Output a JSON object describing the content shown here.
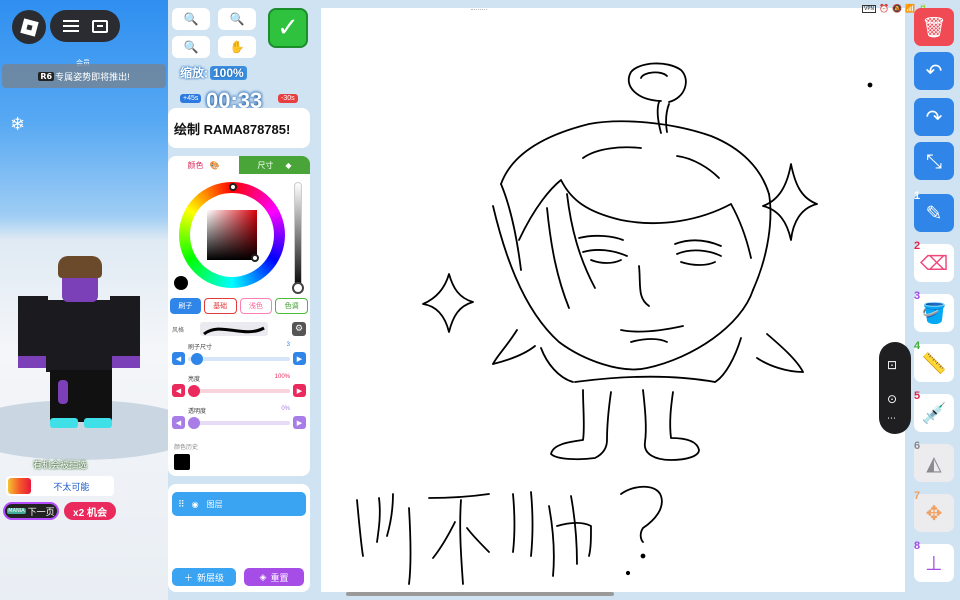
{
  "scene": {
    "tiny_label": "会员",
    "announcement_badge": "R6",
    "announcement_text": "专属姿势即将推出!",
    "snow_icon": "❄",
    "chance_label": "有机会被抽选",
    "chance_status": "不太可能",
    "chance_fill_fraction": 0.22,
    "next_button_badge": "MANIA",
    "next_button_label": "下一页",
    "x2_button_label": "x2 机会"
  },
  "toolbar_top": {
    "zoom_out_icon": "🔍",
    "zoom_in_icon": "🔍",
    "zoom_fit_icon": "🔍",
    "hand_icon": "✋",
    "confirm_icon": "✓",
    "zoom_label": "缩放:",
    "zoom_value": "100%"
  },
  "timer": {
    "plus_badge": "+45s",
    "minus_badge": "-30s",
    "time": "00:33"
  },
  "prompt": {
    "text": "绘制 RAMA878785!"
  },
  "color_panel": {
    "tab_color": "颜色",
    "tab_size": "尺寸",
    "current_color": "#000000",
    "chips": [
      "刷子",
      "基础",
      "浅色",
      "色调"
    ],
    "style_label": "风格",
    "sliders": [
      {
        "label": "刷子尺寸",
        "value": "3",
        "accent": "#2f86e8",
        "track": "#d6e6f8",
        "fraction": 0.03
      },
      {
        "label": "亮度",
        "value": "100%",
        "accent": "#ea2a5c",
        "track": "#f8d3dc",
        "fraction": 0.0
      },
      {
        "label": "透明度",
        "value": "0%",
        "accent": "#a87de8",
        "track": "#e6dcf6",
        "fraction": 0.0
      }
    ],
    "history_label": "颜色历史"
  },
  "layers": {
    "layer_name": "图层",
    "new_layer_label": "新层级",
    "reset_label": "重置"
  },
  "status": {
    "icons": [
      "VPN",
      "⏰",
      "🔕",
      "📶",
      "🔋"
    ]
  },
  "right_toolbar": {
    "trash_icon": "🗑",
    "undo_icon": "↶",
    "redo_icon": "↷",
    "shrink_icon": "⤡",
    "tools": [
      {
        "num": "1",
        "icon": "✎",
        "color": "#ffffff",
        "num_color": "#ffffff",
        "state": "active"
      },
      {
        "num": "2",
        "icon": "⌫",
        "color": "#f0487a",
        "num_color": "#e0284a",
        "state": "plain"
      },
      {
        "num": "3",
        "icon": "🪣",
        "color": "#a64de8",
        "num_color": "#a64de8",
        "state": "plain"
      },
      {
        "num": "4",
        "icon": "📏",
        "color": "#3fae3a",
        "num_color": "#3fae3a",
        "state": "plain"
      },
      {
        "num": "5",
        "icon": "💉",
        "color": "#f0487a",
        "num_color": "#e0284a",
        "state": "plain"
      },
      {
        "num": "6",
        "icon": "◭",
        "color": "#8a8a8f",
        "num_color": "#8a8a8f",
        "state": "disabled"
      },
      {
        "num": "7",
        "icon": "✥",
        "color": "#f0a060",
        "num_color": "#f0a060",
        "state": "disabled"
      },
      {
        "num": "8",
        "icon": "⊥",
        "color": "#a64de8",
        "num_color": "#a64de8",
        "state": "plain"
      }
    ]
  },
  "camera_panel": {
    "screenshot_icon": "⊡",
    "record_icon": "⊙",
    "more_icon": "⋯"
  },
  "colors": {
    "accent_blue": "#2f86e8",
    "confirm_green": "#2ec23e",
    "trash_red": "#f04a55",
    "purple": "#a64de8"
  }
}
